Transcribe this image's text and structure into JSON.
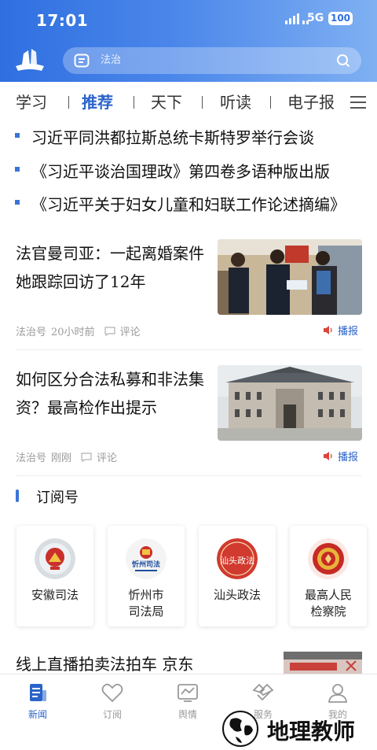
{
  "status_bar": {
    "time": "17:01",
    "network": "5G",
    "battery": "100"
  },
  "search": {
    "placeholder": "法治"
  },
  "tabs": [
    {
      "label": "学习"
    },
    {
      "label": "推荐"
    },
    {
      "label": "天下"
    },
    {
      "label": "听读"
    },
    {
      "label": "电子报"
    }
  ],
  "headlines": [
    {
      "text": "习近平同洪都拉斯总统卡斯特罗举行会谈"
    },
    {
      "text": "《习近平谈治国理政》第四卷多语种版出版"
    },
    {
      "text": "《习近平关于妇女儿童和妇联工作论述摘编》"
    }
  ],
  "news": [
    {
      "title": "法官曼司亚：一起离婚案件她跟踪回访了12年",
      "source": "法治号",
      "time": "20小时前",
      "comment_label": "评论",
      "broadcast_label": "播报"
    },
    {
      "title": "如何区分合法私募和非法集资？最高检作出提示",
      "source": "法治号",
      "time": "刚刚",
      "comment_label": "评论",
      "broadcast_label": "播报"
    }
  ],
  "subscriptions": {
    "title": "订阅号",
    "items": [
      {
        "name": "安徽司法",
        "logo_text": ""
      },
      {
        "name": "忻州市\n司法局",
        "logo_text": "忻州司法"
      },
      {
        "name": "汕头政法",
        "logo_text": "汕头政法"
      },
      {
        "name": "最高人民\n检察院",
        "logo_text": ""
      }
    ]
  },
  "partial_article": {
    "title": "线上直播拍卖法拍车 京东"
  },
  "bottom_nav": [
    {
      "label": "新闻",
      "icon": "news-icon"
    },
    {
      "label": "订阅",
      "icon": "heart-icon"
    },
    {
      "label": "舆情",
      "icon": "chart-icon"
    },
    {
      "label": "服务",
      "icon": "handshake-icon"
    },
    {
      "label": "我的",
      "icon": "person-icon"
    }
  ],
  "watermark": {
    "text": "地理教师"
  },
  "colors": {
    "accent": "#2a63c9",
    "header_start": "#2f6fe0",
    "header_end": "#7fb0f2"
  }
}
